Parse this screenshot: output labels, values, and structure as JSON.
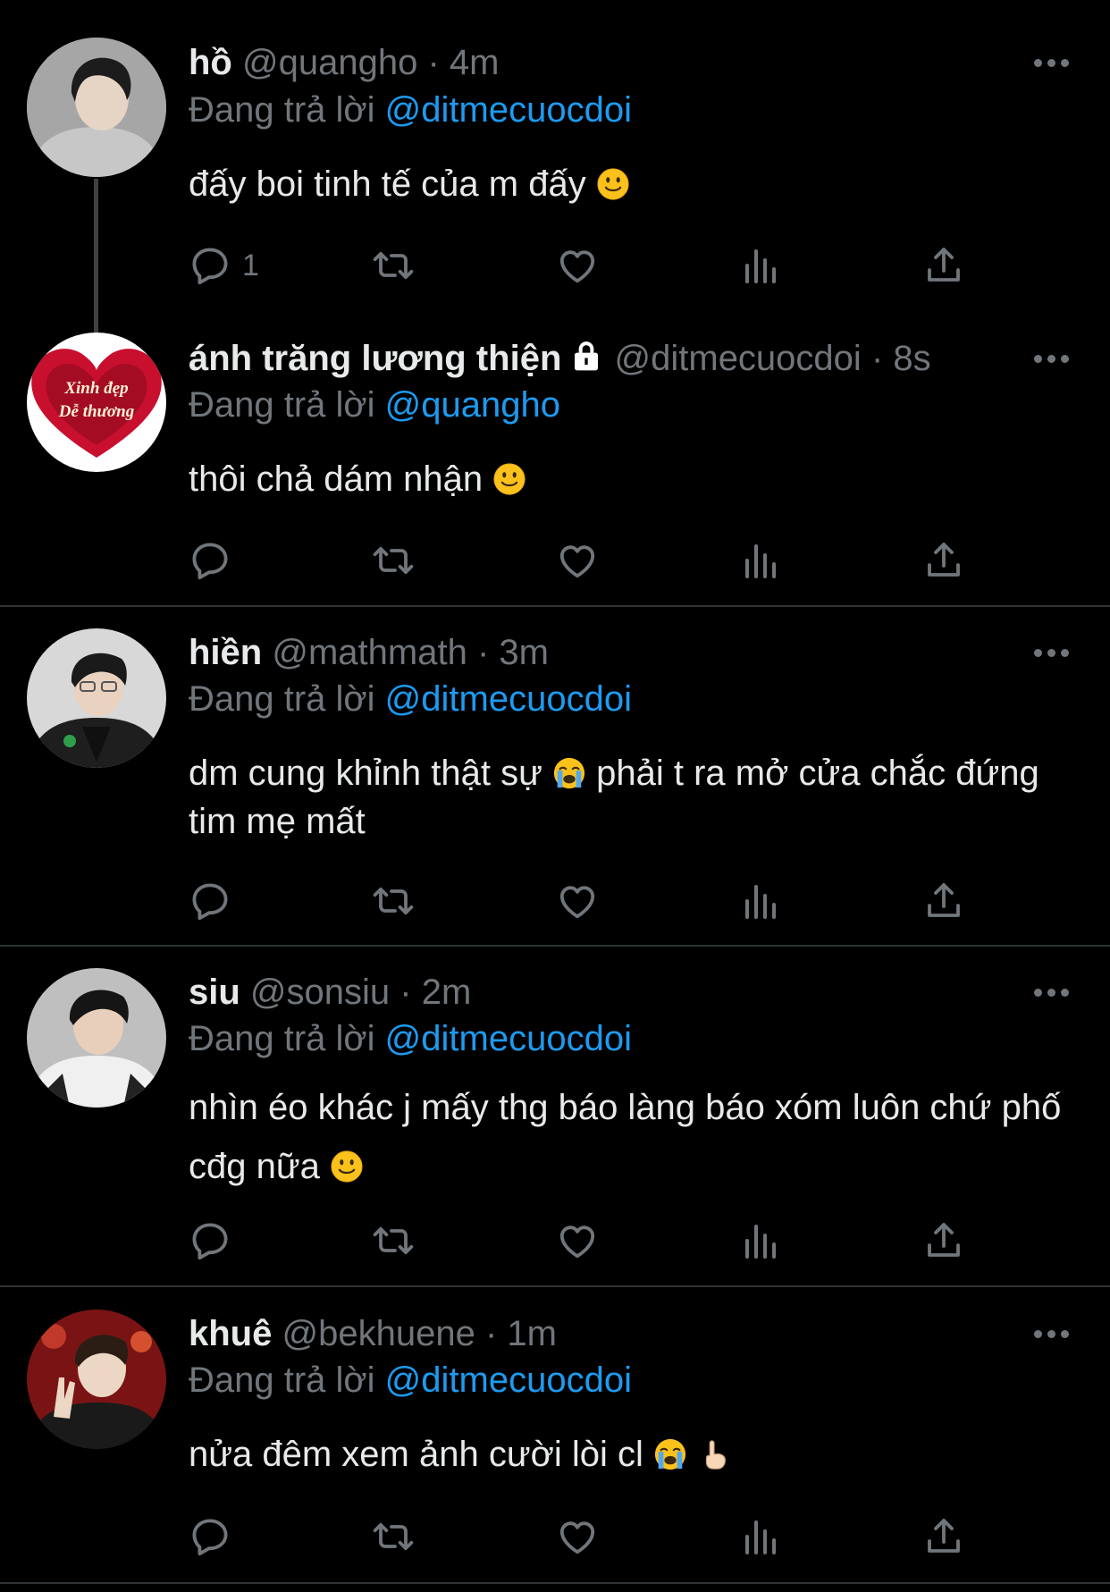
{
  "tweets": [
    {
      "display_name": "hồ",
      "handle": "@quangho",
      "time": "4m",
      "replying_prefix": "Đang trả lời",
      "replying_to": "@ditmecuocdoi",
      "text": "đấy boi tinh tế của m đấy",
      "emoji": [
        "slight-smile"
      ],
      "reply_count": "1"
    },
    {
      "display_name": "ánh trăng lương thiện",
      "handle": "@ditmecuocdoi",
      "time": "8s",
      "replying_prefix": "Đang trả lời",
      "replying_to": "@quangho",
      "text": "thôi chả dám nhận",
      "emoji": [
        "slight-smile"
      ],
      "avatar_text_1": "Xinh đẹp",
      "avatar_text_2": "Dễ thương",
      "locked": true
    },
    {
      "display_name": "hiền",
      "handle": "@mathmath",
      "time": "3m",
      "replying_prefix": "Đang trả lời",
      "replying_to": "@ditmecuocdoi",
      "text_part1": "dm cung khỉnh thật sự",
      "text_part2": "phải t ra mở cửa chắc đứng tim mẹ mất",
      "emoji": [
        "loudly-crying"
      ]
    },
    {
      "display_name": "siu",
      "handle": "@sonsiu",
      "time": "2m",
      "replying_prefix": "Đang trả lời",
      "replying_to": "@ditmecuocdoi",
      "text": "nhìn éo khác j mấy thg báo làng báo xóm luôn chứ phố cđg nữa",
      "emoji": [
        "slight-smile"
      ]
    },
    {
      "display_name": "khuê",
      "handle": "@bekhuene",
      "time": "1m",
      "replying_prefix": "Đang trả lời",
      "replying_to": "@ditmecuocdoi",
      "text": "nửa đêm xem ảnh cười lòi cl",
      "emoji": [
        "loudly-crying",
        "pointing-up"
      ]
    }
  ],
  "separator": "·",
  "action_icons": [
    "reply-icon",
    "retweet-icon",
    "like-icon",
    "views-icon",
    "share-icon"
  ],
  "colors": {
    "background": "#000000",
    "text": "#e7e9ea",
    "muted": "#71767b",
    "link": "#1d9bf0",
    "divider": "#2f3336"
  }
}
